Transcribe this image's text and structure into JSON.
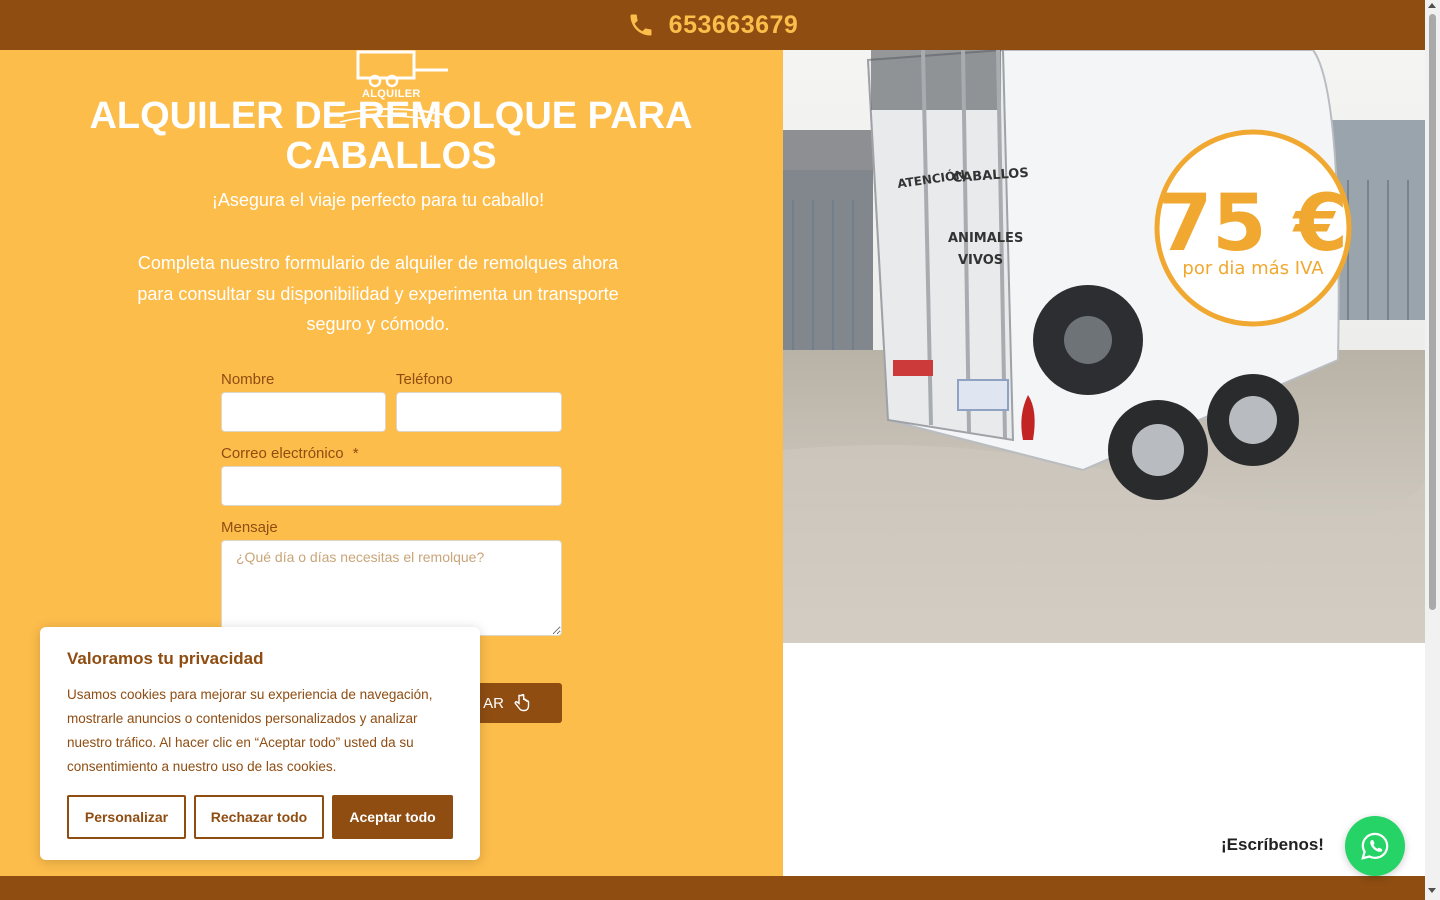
{
  "topbar": {
    "phone_number": "653663679",
    "icon": "phone-icon"
  },
  "logo": {
    "text": "ALQUILER"
  },
  "hero": {
    "title_line1": "ALQUILER DE REMOLQUE PARA",
    "title_line2": "CABALLOS",
    "subtitle": "¡Asegura el viaje perfecto para tu caballo!",
    "description": "Completa nuestro formulario de alquiler de remolques ahora para consultar su disponibilidad y experimenta un transporte seguro y cómodo."
  },
  "form": {
    "name_label": "Nombre",
    "name_value": "",
    "phone_label": "Teléfono",
    "phone_value": "",
    "email_label": "Correo electrónico",
    "email_required_mark": "*",
    "email_value": "",
    "message_label": "Mensaje",
    "message_placeholder": "¿Qué día o días necesitas el remolque?",
    "submit_label_visible": "AR"
  },
  "photo": {
    "price": "75 €",
    "price_caption": "por dia más IVA",
    "trailer_text_1": "ATENCIÓN",
    "trailer_text_2": "CABALLOS",
    "trailer_text_3": "ANIMALES",
    "trailer_text_4": "VIVOS"
  },
  "cookie": {
    "title": "Valoramos tu privacidad",
    "text": "Usamos cookies para mejorar su experiencia de navegación, mostrarle anuncios o contenidos personalizados y analizar nuestro tráfico. Al hacer clic en “Aceptar todo” usted da su consentimiento a nuestro uso de las cookies.",
    "customize_label": "Personalizar",
    "reject_label": "Rechazar todo",
    "accept_label": "Aceptar todo"
  },
  "whatsapp": {
    "label": "¡Escríbenos!",
    "icon": "whatsapp-icon"
  },
  "colors": {
    "brand_brown": "#8f4d12",
    "brand_yellow": "#fdbd4b",
    "price_orange": "#f0a830",
    "whatsapp_green": "#25d366"
  }
}
